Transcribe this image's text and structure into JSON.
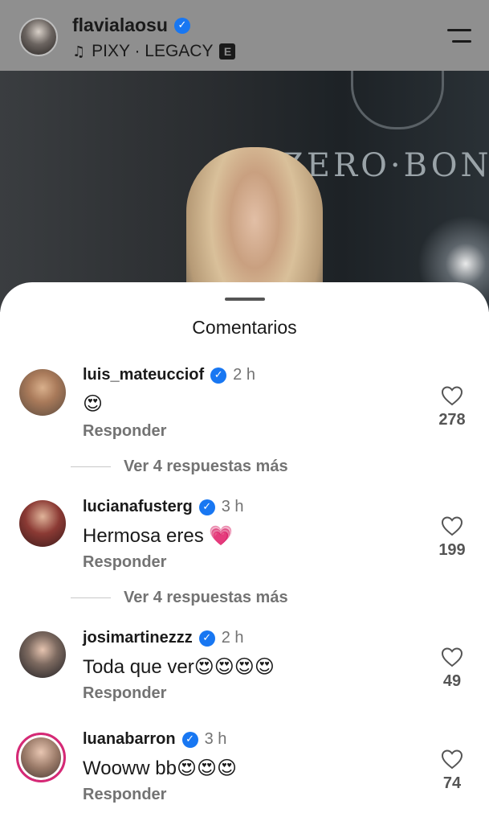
{
  "header": {
    "username": "flavialaosu",
    "verified_mark": "✓",
    "music_icon": "music-note-icon",
    "music_label": "PIXY · LEGACY",
    "explicit_badge": "E",
    "menu_icon": "hamburger-menu-icon"
  },
  "photo": {
    "sign_text": "ZERO·BON"
  },
  "comments_sheet": {
    "title": "Comentarios",
    "reply_label": "Responder",
    "comments": [
      {
        "username": "luis_mateucciof",
        "verified": true,
        "time": "2 h",
        "text": "",
        "emoji": "😍",
        "likes": "278",
        "more_replies": "Ver 4 respuestas más"
      },
      {
        "username": "lucianafusterg",
        "verified": true,
        "time": "3 h",
        "text": "Hermosa eres",
        "emoji": "💗",
        "likes": "199",
        "more_replies": "Ver 4 respuestas más"
      },
      {
        "username": "josimartinezzz",
        "verified": true,
        "time": "2 h",
        "text": "Toda que ver",
        "emoji": "😍😍😍😍",
        "likes": "49"
      },
      {
        "username": "luanabarron",
        "verified": true,
        "time": "3 h",
        "text": "Wooww bb",
        "emoji": "😍😍😍",
        "likes": "74"
      }
    ]
  },
  "colors": {
    "verified_blue": "#1877f2",
    "secondary_text": "#737373",
    "heart_color": "#e8426d"
  }
}
